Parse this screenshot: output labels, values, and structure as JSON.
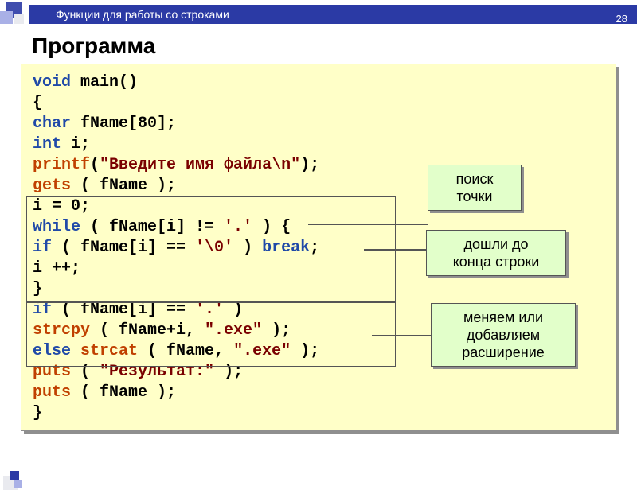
{
  "header": {
    "breadcrumb": "Функции для работы со строками",
    "page_number": "28"
  },
  "title": "Программа",
  "code": {
    "l1_kw": "void",
    "l1_fn": " main()",
    "l2": "{",
    "l3_kw": "char",
    "l3_rest": "  fName[80];",
    "l4_kw": "int",
    "l4_rest": "  i;",
    "l5_fn": "printf",
    "l5_par": "(",
    "l5_str": "\"Введите имя файла\\n\"",
    "l5_end": ");",
    "l6_fn": "gets",
    "l6_rest": " ( fName );",
    "l7": "i = 0;",
    "l8_kw": "while",
    "l8_rest": " ( fName[i] != ",
    "l8_ch": "'.'",
    "l8_end": " ) {",
    "l9_a": "    ",
    "l9_kw": "if",
    "l9_b": " ( fName[i] == ",
    "l9_ch": "'\\0'",
    "l9_c": " ) ",
    "l9_br": "break",
    "l9_d": ";",
    "l10": "    i ++;",
    "l11": "    }",
    "l12_kw": "if",
    "l12_a": " ( fName[i] == ",
    "l12_ch": "'.'",
    "l12_b": " )",
    "l13_a": "     ",
    "l13_fn": "strcpy",
    "l13_b": " ( fName+i, ",
    "l13_str": "\".exe\"",
    "l13_c": " );",
    "l14_kw": "else",
    "l14_sp": " ",
    "l14_fn": "strcat",
    "l14_b": " ( fName, ",
    "l14_str": "\".exe\"",
    "l14_c": " );",
    "l15_fn": "puts",
    "l15_a": " ( ",
    "l15_str": "\"Результат:\"",
    "l15_b": " );",
    "l16_fn": "puts",
    "l16_rest": " ( fName );",
    "l17": "}"
  },
  "callouts": {
    "c1_l1": "поиск",
    "c1_l2": "точки",
    "c2_l1": "дошли до",
    "c2_l2": "конца строки",
    "c3_l1": "меняем или",
    "c3_l2": "добавляем",
    "c3_l3": "расширение"
  }
}
